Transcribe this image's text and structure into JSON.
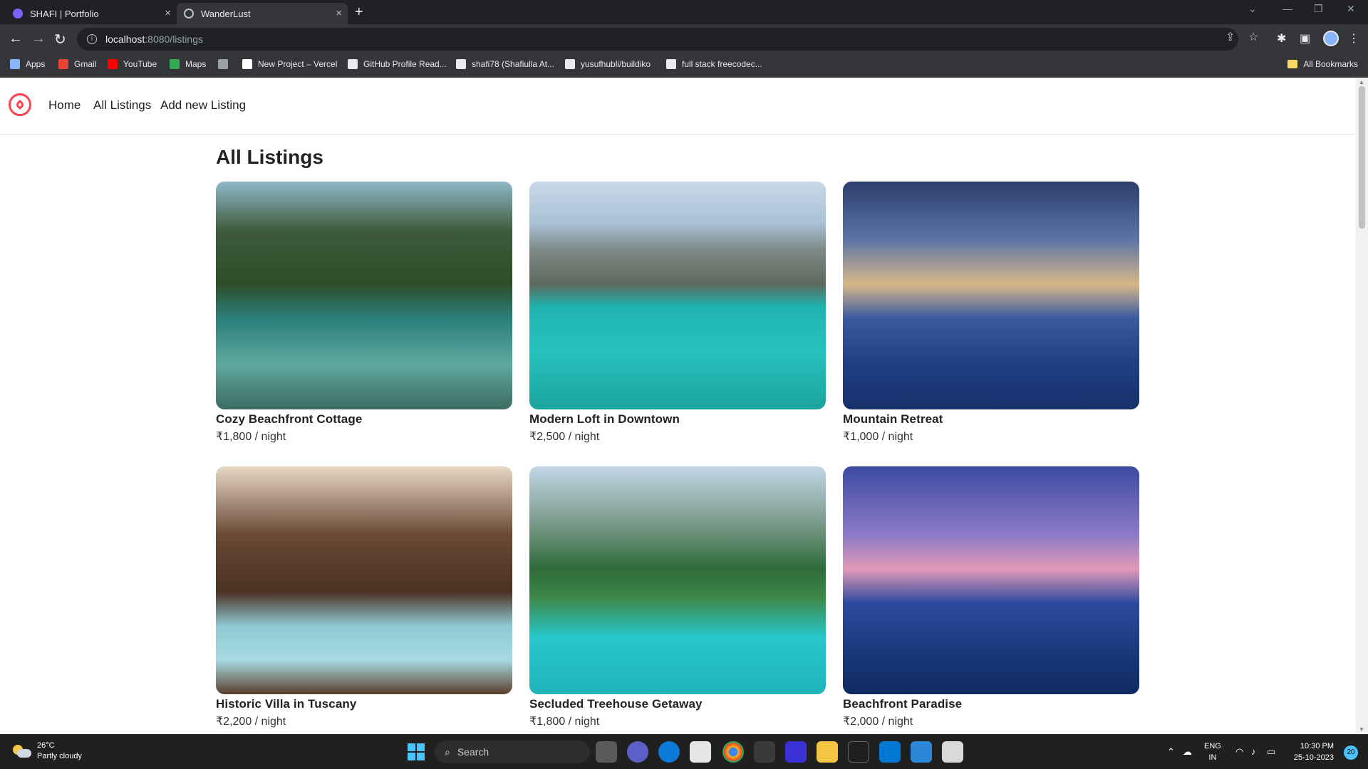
{
  "browser": {
    "tabs": [
      {
        "title": "SHAFI | Portfolio",
        "active": false
      },
      {
        "title": "WanderLust",
        "active": true
      }
    ],
    "url_host": "localhost",
    "url_path": ":8080/listings",
    "bookmarks": [
      {
        "label": "Apps",
        "icon": "apps-grid-icon",
        "color": "#8ab4f8"
      },
      {
        "label": "Gmail",
        "icon": "gmail-icon",
        "color": "#ea4335"
      },
      {
        "label": "YouTube",
        "icon": "youtube-icon",
        "color": "#ff0000"
      },
      {
        "label": "Maps",
        "icon": "maps-icon",
        "color": "#34a853"
      },
      {
        "label": "",
        "icon": "globe-icon",
        "color": "#9aa0a6"
      },
      {
        "label": "New Project – Vercel",
        "icon": "vercel-icon",
        "color": "#ffffff"
      },
      {
        "label": "GitHub Profile Read...",
        "icon": "readme-icon",
        "color": "#e8eaed"
      },
      {
        "label": "shafi78 (Shafiulla At...",
        "icon": "github-icon",
        "color": "#e8eaed"
      },
      {
        "label": "yusufhubli/buildiko",
        "icon": "github-icon",
        "color": "#e8eaed"
      },
      {
        "label": "full stack freecodec...",
        "icon": "freecodecamp-icon",
        "color": "#e8eaed"
      }
    ],
    "all_bookmarks": "All Bookmarks"
  },
  "nav": {
    "links": [
      "Home",
      "All Listings",
      "Add new Listing"
    ],
    "accent": "#fe424d"
  },
  "page": {
    "title": "All Listings"
  },
  "listings": [
    {
      "title": "Cozy Beachfront Cottage",
      "price": "₹1,800 / night"
    },
    {
      "title": "Modern Loft in Downtown",
      "price": "₹2,500 / night"
    },
    {
      "title": "Mountain Retreat",
      "price": "₹1,000 / night"
    },
    {
      "title": "Historic Villa in Tuscany",
      "price": "₹2,200 / night"
    },
    {
      "title": "Secluded Treehouse Getaway",
      "price": "₹1,800 / night"
    },
    {
      "title": "Beachfront Paradise",
      "price": "₹2,000 / night"
    }
  ],
  "taskbar": {
    "temperature": "26°C",
    "weather": "Partly cloudy",
    "search": "Search",
    "lang_top": "ENG",
    "lang_bottom": "IN",
    "time": "10:30 PM",
    "date": "25-10-2023",
    "notifications": "20"
  }
}
